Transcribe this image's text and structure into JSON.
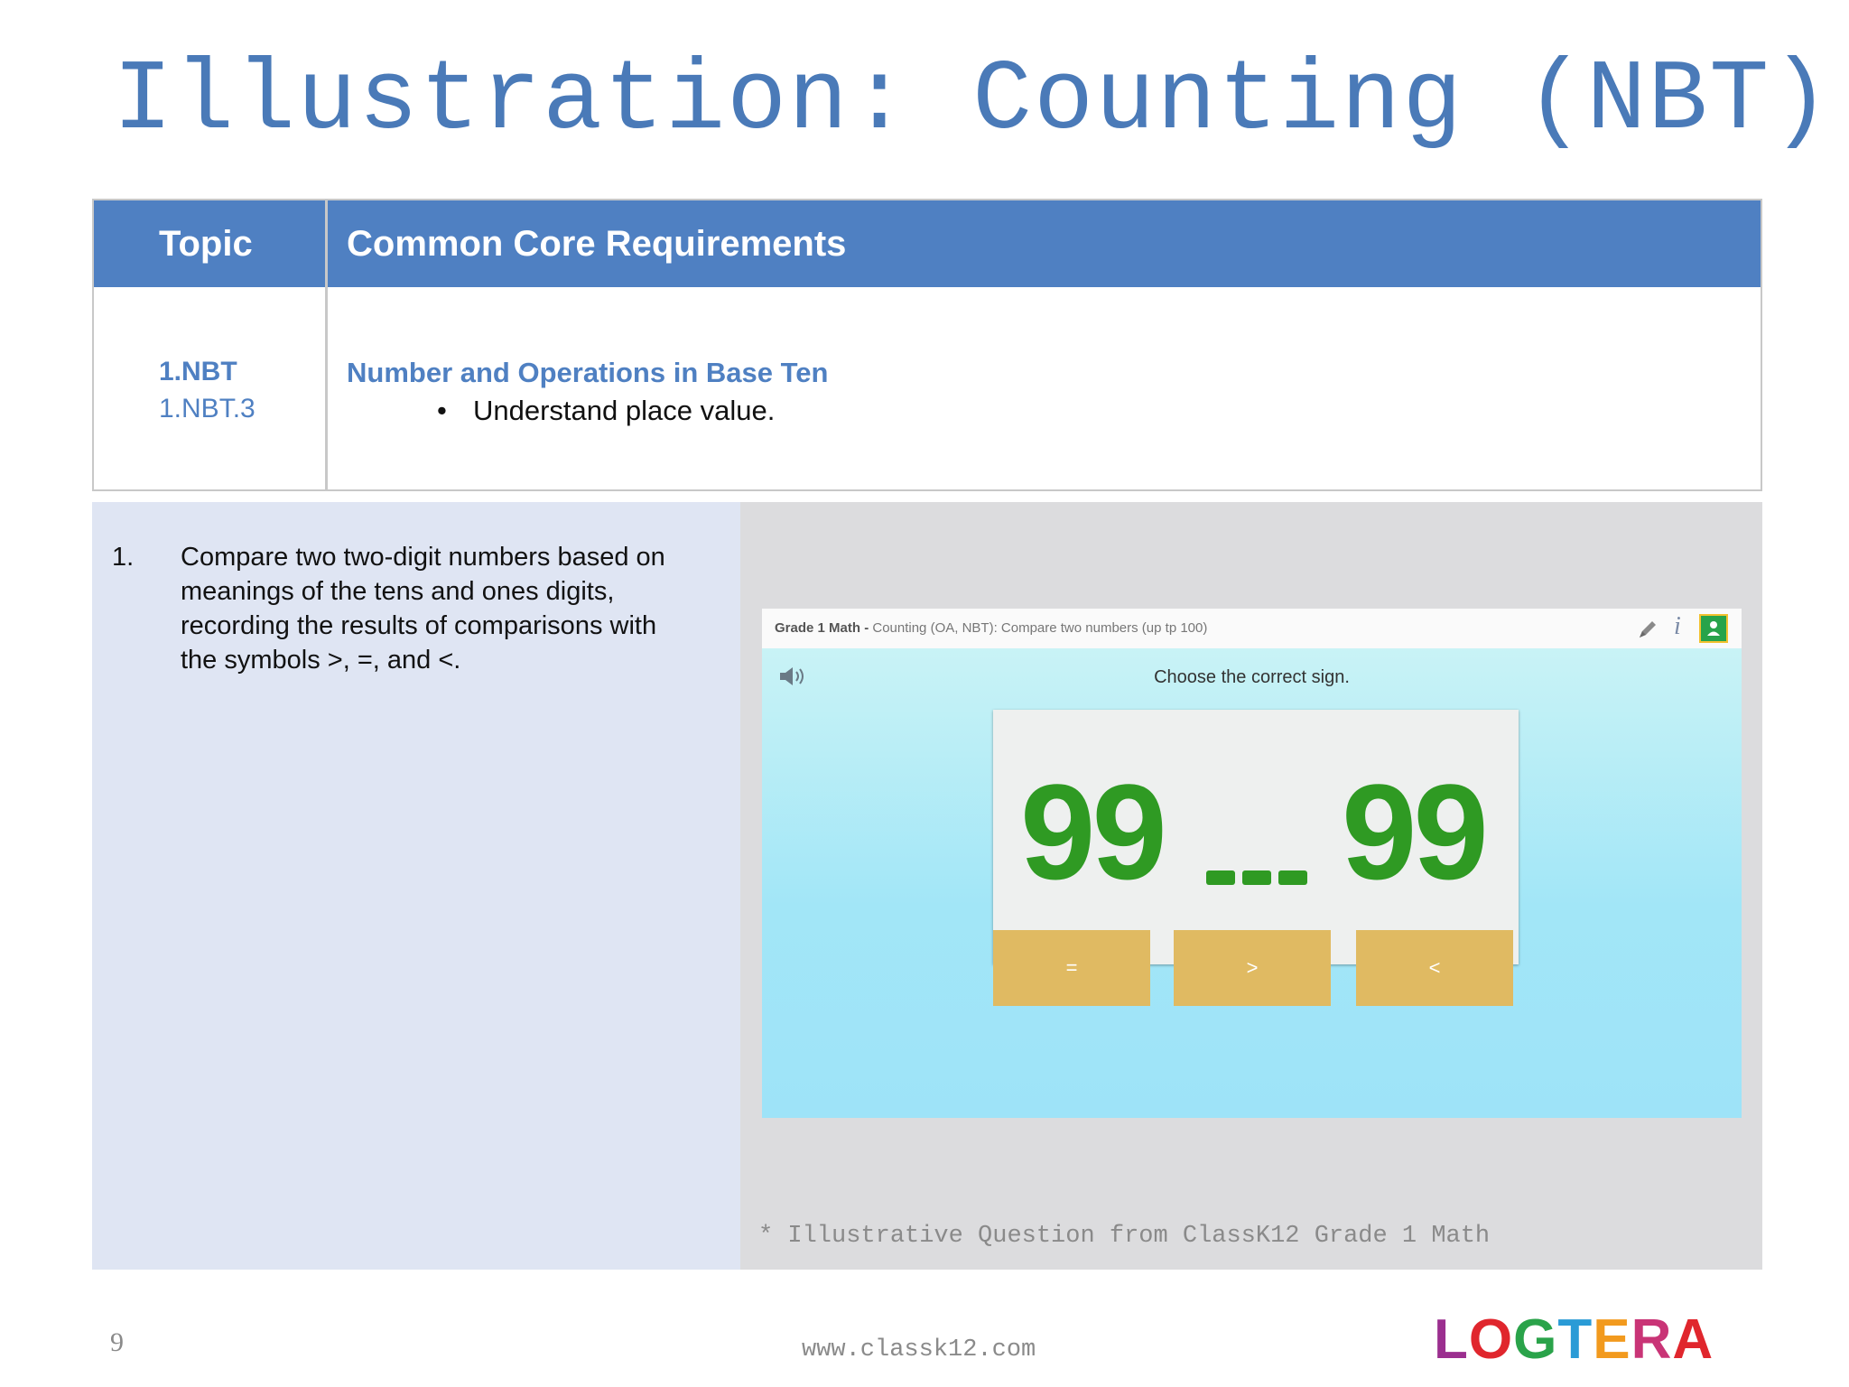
{
  "title": "Illustration: Counting (NBT)",
  "table": {
    "header_topic": "Topic",
    "header_requirements": "Common Core Requirements",
    "topic_code": "1.NBT",
    "topic_subcode": "1.NBT.3",
    "domain_heading": "Number and Operations in Base Ten",
    "bullet_marker": "•",
    "bullet_text": "Understand place value."
  },
  "standard": {
    "number": "1.",
    "text": "Compare two two-digit numbers based on meanings of the tens and ones digits, recording the results of comparisons with the symbols >, =, and <."
  },
  "screenshot": {
    "breadcrumb_strong": "Grade 1 Math - ",
    "breadcrumb_rest": "Counting (OA, NBT): Compare two numbers (up tp 100)",
    "info_icon_text": "i",
    "prompt": "Choose the correct sign.",
    "left_number": "99",
    "right_number": "99",
    "choices": [
      "=",
      ">",
      "<"
    ],
    "icons": [
      "pencil-icon",
      "info-icon",
      "google-classroom-icon",
      "speaker-icon"
    ],
    "colors": {
      "number": "#2f9a23",
      "choice_button": "#e0ba62",
      "background": "#9ee3f2"
    }
  },
  "caption": "* Illustrative Question from ClassK12 Grade 1 Math",
  "footer": {
    "page_number": "9",
    "url": "www.classk12.com",
    "logo_text": "LOGTERA"
  },
  "colors": {
    "title": "#4a7ab8",
    "table_header": "#4f80c2",
    "left_panel": "#dfe5f3",
    "right_panel": "#dcdcde"
  }
}
